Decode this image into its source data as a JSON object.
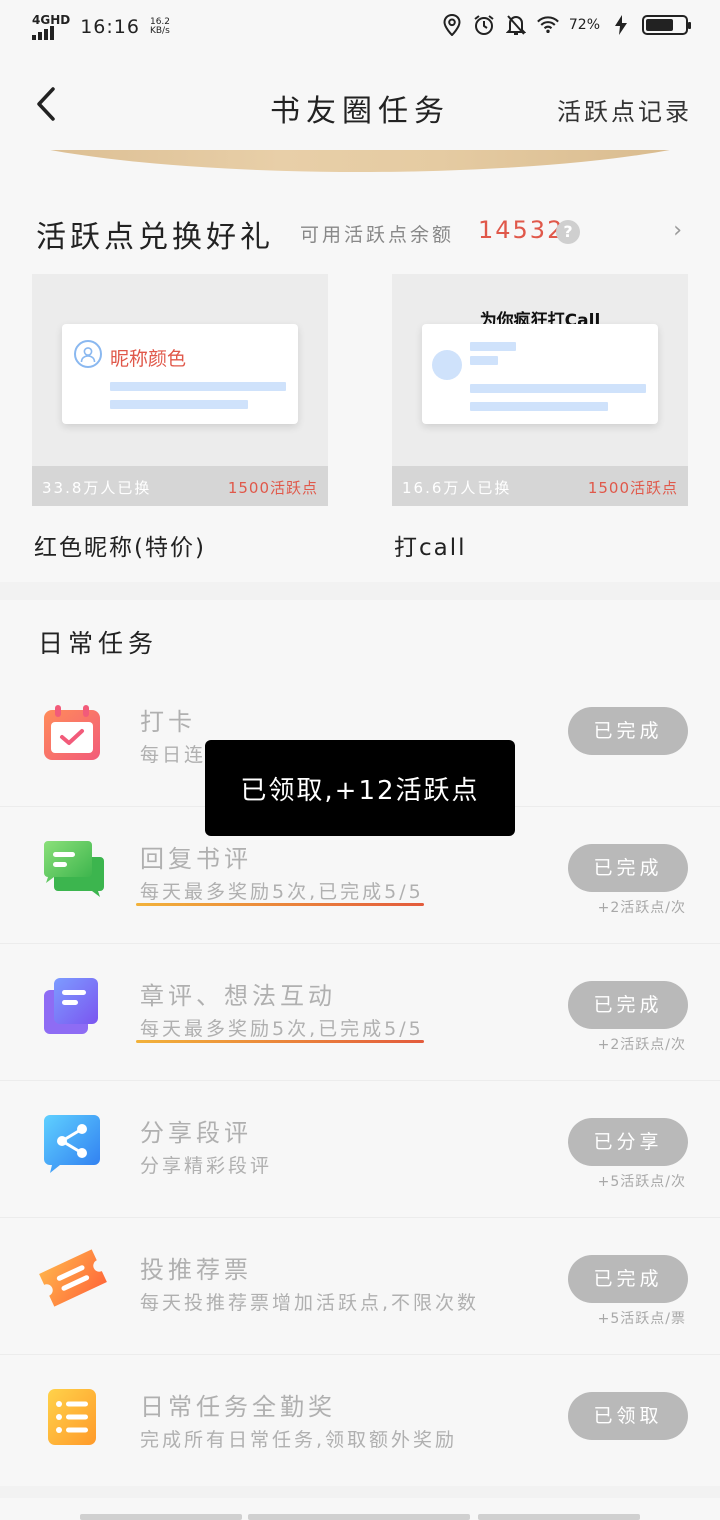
{
  "status_bar": {
    "network": "4GHD",
    "time": "16:16",
    "speed": "16.2\nKB/s",
    "battery_percent": "72%",
    "battery_level": 0.72,
    "icons": [
      "location-icon",
      "alarm-icon",
      "mute-icon",
      "wifi-icon",
      "charging-icon",
      "battery-icon"
    ]
  },
  "nav": {
    "back_icon": "chevron-left-icon",
    "title": "书友圈任务",
    "right_link": "活跃点记录"
  },
  "exchange": {
    "title": "活跃点兑换好礼",
    "balance_label": "可用活跃点余额",
    "balance": "14532",
    "help": "?",
    "more": "›",
    "gifts": [
      {
        "preview_text": "昵称颜色",
        "count": "33.8万人已换",
        "cost": "1500活跃点",
        "name": "红色昵称(特价)"
      },
      {
        "preview_text": "为你疯狂打Call",
        "count": "16.6万人已换",
        "cost": "1500活跃点",
        "name": "打call"
      }
    ]
  },
  "daily": {
    "title": "日常任务",
    "tasks": [
      {
        "icon": "calendar-check-icon",
        "name": "打卡",
        "desc": "每日连",
        "button": "已完成",
        "reward": ""
      },
      {
        "icon": "chat-bubbles-icon",
        "name": "回复书评",
        "desc": "每天最多奖励5次,已完成5/5",
        "button": "已完成",
        "reward": "+2活跃点/次"
      },
      {
        "icon": "note-cards-icon",
        "name": "章评、想法互动",
        "desc": "每天最多奖励5次,已完成5/5",
        "button": "已完成",
        "reward": "+2活跃点/次"
      },
      {
        "icon": "share-icon",
        "name": "分享段评",
        "desc": "分享精彩段评",
        "button": "已分享",
        "reward": "+5活跃点/次"
      },
      {
        "icon": "ticket-icon",
        "name": "投推荐票",
        "desc": "每天投推荐票增加活跃点,不限次数",
        "button": "已完成",
        "reward": "+5活跃点/票"
      },
      {
        "icon": "checklist-icon",
        "name": "日常任务全勤奖",
        "desc": "完成所有日常任务,领取额外奖励",
        "button": "已领取",
        "reward": ""
      }
    ]
  },
  "toast": {
    "text": "已领取,+12活跃点"
  },
  "colors": {
    "accent_red": "#e0584a",
    "gold": "#d8b98c",
    "disabled_button": "#b9b9b9",
    "progress_gradient_start": "#f2b23a",
    "progress_gradient_end": "#e35b3c"
  }
}
